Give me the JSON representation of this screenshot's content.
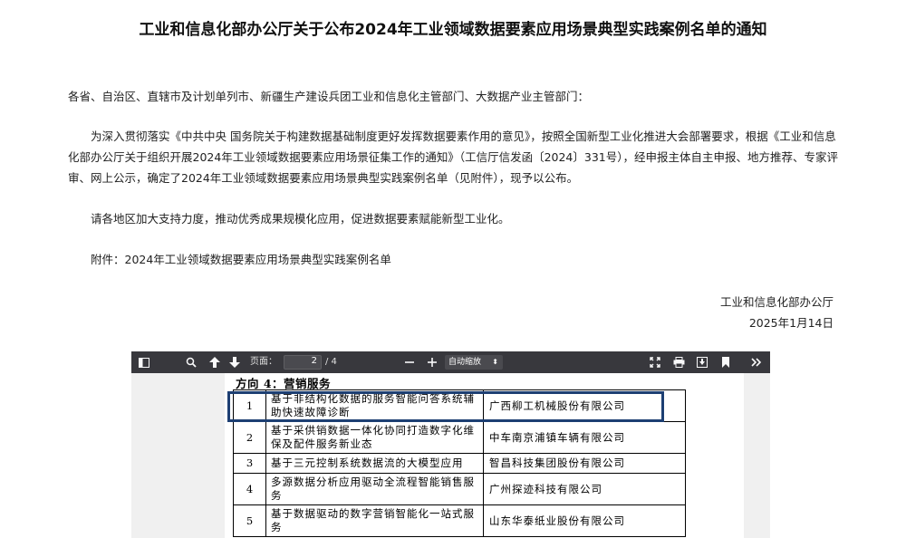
{
  "notice": {
    "title": "工业和信息化部办公厅关于公布2024年工业领域数据要素应用场景典型实践案例名单的通知",
    "salutation": "各省、自治区、直辖市及计划单列市、新疆生产建设兵团工业和信息化主管部门、大数据产业主管部门：",
    "body": "为深入贯彻落实《中共中央 国务院关于构建数据基础制度更好发挥数据要素作用的意见》，按照全国新型工业化推进大会部署要求，根据《工业和信息化部办公厅关于组织开展2024年工业领域数据要素应用场景征集工作的通知》（工信厅信发函〔2024〕331号），经申报主体自主申报、地方推荐、专家评审、网上公示，确定了2024年工业领域数据要素应用场景典型实践案例名单（见附件），现予以公布。",
    "request": "请各地区加大支持力度，推动优秀成果规模化应用，促进数据要素赋能新型工业化。",
    "attachment": "附件：2024年工业领域数据要素应用场景典型实践案例名单",
    "signature_org": "工业和信息化部办公厅",
    "signature_date": "2025年1月14日"
  },
  "viewer": {
    "page_label": "页面：",
    "page_value": "2",
    "page_total": "/ 4",
    "zoom_value": "自动缩放",
    "zoom_arrow": "⬍",
    "icons": [
      "sidebar-toggle-icon",
      "search-icon",
      "previous-page-icon",
      "next-page-icon",
      "zoom-out-icon",
      "zoom-in-icon",
      "presentation-mode-icon",
      "print-icon",
      "download-icon",
      "bookmark-icon",
      "more-tools-icon"
    ],
    "colors": {
      "toolbar": "#38383d",
      "highlight": "#1d3f73"
    }
  },
  "document": {
    "heading": "方向 4：营销服务",
    "rows": [
      {
        "num": "1",
        "name": "基于非结构化数据的服务智能问答系统辅助快速故障诊断",
        "org": "广西柳工机械股份有限公司"
      },
      {
        "num": "2",
        "name": "基于采供销数据一体化协同打造数字化维保及配件服务新业态",
        "org": "中车南京浦镇车辆有限公司"
      },
      {
        "num": "3",
        "name": "基于三元控制系统数据流的大模型应用",
        "org": "智昌科技集团股份有限公司"
      },
      {
        "num": "4",
        "name": "多源数据分析应用驱动全流程智能销售服务",
        "org": "广州探迹科技有限公司"
      },
      {
        "num": "5",
        "name": "基于数据驱动的数字营销智能化一站式服务",
        "org": "山东华泰纸业股份有限公司"
      }
    ]
  }
}
